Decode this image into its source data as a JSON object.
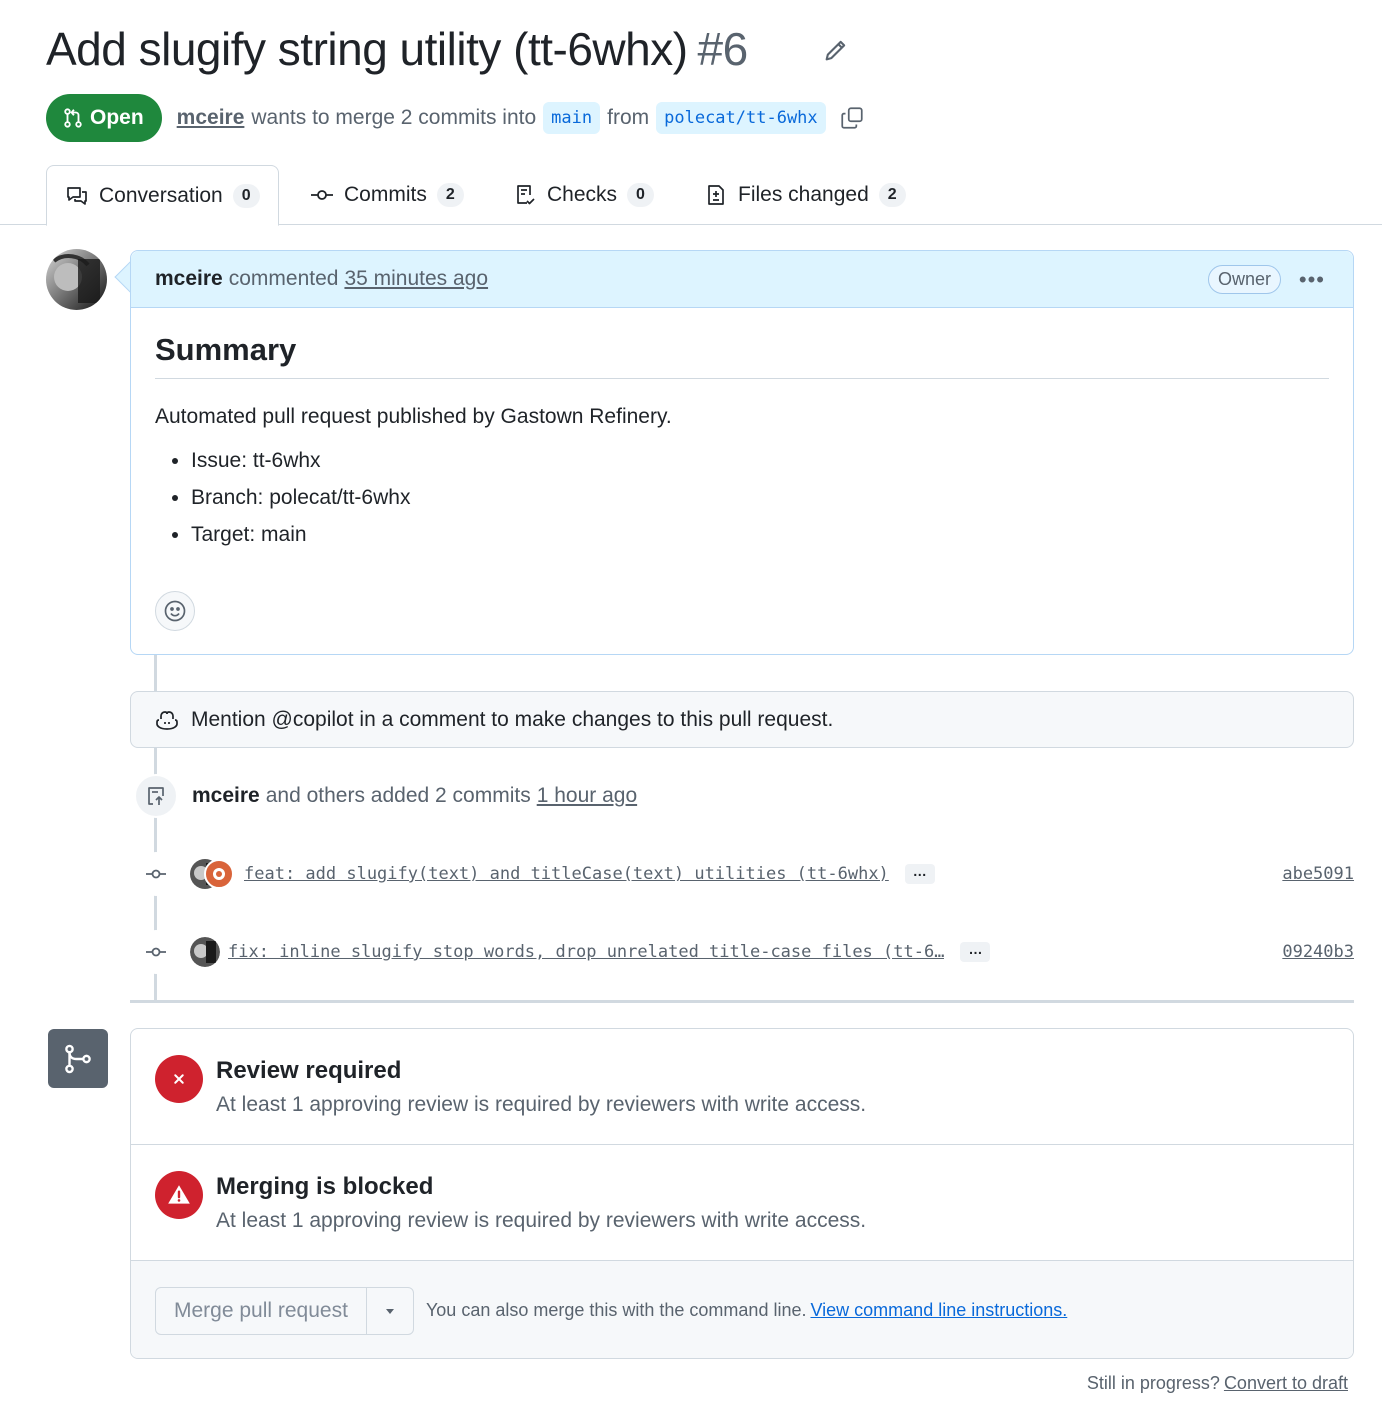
{
  "header": {
    "title": "Add slugify string utility (tt-6whx)",
    "number": "#6",
    "state": "Open",
    "author": "mceire",
    "merge_text": "wants to merge 2 commits into",
    "base_branch": "main",
    "from_text": "from",
    "head_branch": "polecat/tt-6whx"
  },
  "tabs": [
    {
      "label": "Conversation",
      "count": "0"
    },
    {
      "label": "Commits",
      "count": "2"
    },
    {
      "label": "Checks",
      "count": "0"
    },
    {
      "label": "Files changed",
      "count": "2"
    }
  ],
  "comment": {
    "author": "mceire",
    "action": "commented",
    "time": "35 minutes ago",
    "role": "Owner",
    "heading": "Summary",
    "paragraph": "Automated pull request published by Gastown Refinery.",
    "bullets": [
      "Issue: tt-6whx",
      "Branch: polecat/tt-6whx",
      "Target: main"
    ]
  },
  "copilot_notice": "Mention @copilot in a comment to make changes to this pull request.",
  "commits_event": {
    "author": "mceire",
    "text": "and others added 2 commits",
    "time": "1 hour ago"
  },
  "commits": [
    {
      "message": "feat: add slugify(text) and titleCase(text) utilities (tt-6whx)",
      "sha": "abe5091"
    },
    {
      "message": "fix: inline slugify stop words, drop unrelated title-case files (tt-6…",
      "sha": "09240b3"
    }
  ],
  "merge": {
    "review_title": "Review required",
    "review_desc": "At least 1 approving review is required by reviewers with write access.",
    "blocked_title": "Merging is blocked",
    "blocked_desc": "At least 1 approving review is required by reviewers with write access.",
    "button_label": "Merge pull request",
    "hint_text": "You can also merge this with the command line.",
    "hint_link": "View command line instructions."
  },
  "footer": {
    "question": "Still in progress?",
    "link": "Convert to draft"
  },
  "colors": {
    "open_green": "#1f883d",
    "link_blue": "#0969da",
    "danger_red": "#cf222e",
    "comment_header": "#ddf4ff"
  }
}
